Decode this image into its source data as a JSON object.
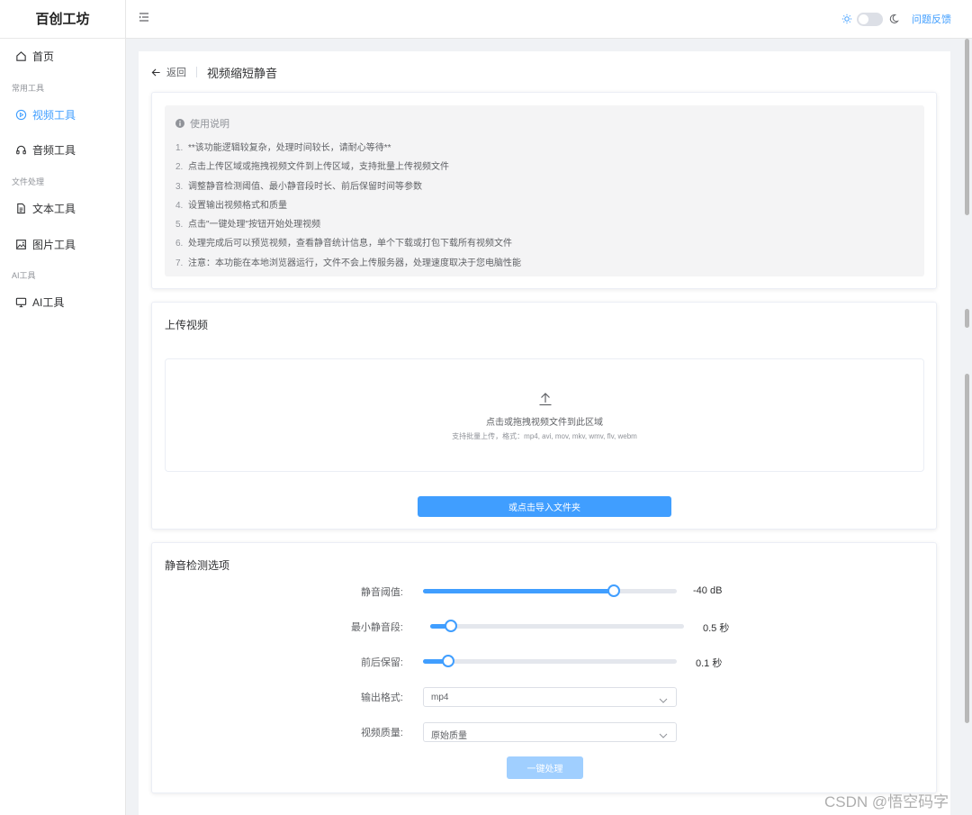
{
  "app": {
    "brand": "百创工坊"
  },
  "sidebar": {
    "items": [
      {
        "label": "首页",
        "icon": "home-icon"
      },
      {
        "label": "视频工具",
        "icon": "play-circle-icon",
        "active": true
      },
      {
        "label": "音频工具",
        "icon": "headphones-icon"
      },
      {
        "label": "文本工具",
        "icon": "document-icon"
      },
      {
        "label": "图片工具",
        "icon": "image-icon"
      },
      {
        "label": "AI工具",
        "icon": "monitor-icon"
      }
    ],
    "groups": [
      "常用工具",
      "文件处理",
      "AI工具"
    ]
  },
  "header": {
    "feedback": "问题反馈",
    "dark_mode": false
  },
  "page": {
    "back_label": "返回",
    "title": "视频缩短静音"
  },
  "instructions": {
    "title": "使用说明",
    "items": [
      {
        "num": "1.",
        "text": "**该功能逻辑较复杂，处理时间较长，请耐心等待**"
      },
      {
        "num": "2.",
        "text": "点击上传区域或拖拽视频文件到上传区域，支持批量上传视频文件"
      },
      {
        "num": "3.",
        "text": "调整静音检测阈值、最小静音段时长、前后保留时间等参数"
      },
      {
        "num": "4.",
        "text": "设置输出视频格式和质量"
      },
      {
        "num": "5.",
        "text": "点击\"一键处理\"按钮开始处理视频"
      },
      {
        "num": "6.",
        "text": "处理完成后可以预览视频，查看静音统计信息，单个下载或打包下载所有视频文件"
      },
      {
        "num": "7.",
        "text": "注意：本功能在本地浏览器运行，文件不会上传服务器，处理速度取决于您电脑性能"
      }
    ]
  },
  "upload": {
    "title": "上传视频",
    "drop_text": "点击或拖拽视频文件到此区域",
    "drop_hint": "支持批量上传，格式：mp4, avi, mov, mkv, wmv, flv, webm",
    "folder_button": "或点击导入文件夹"
  },
  "options": {
    "title": "静音检测选项",
    "threshold": {
      "label": "静音阈值:",
      "value_text": "-40 dB",
      "fraction": 0.75
    },
    "min_silence": {
      "label": "最小静音段:",
      "value_text": "0.5 秒",
      "fraction": 0.08
    },
    "padding": {
      "label": "前后保留:",
      "value_text": "0.1 秒",
      "fraction": 0.1
    },
    "format": {
      "label": "输出格式:",
      "value": "mp4"
    },
    "quality": {
      "label": "视频质量:",
      "value": "原始质量"
    },
    "process_button": "一键处理"
  },
  "watermark": "CSDN @悟空码字",
  "colors": {
    "primary": "#409eff",
    "primary_disabled": "#a0cfff"
  }
}
